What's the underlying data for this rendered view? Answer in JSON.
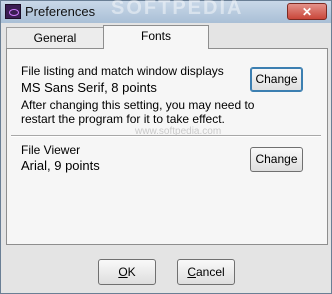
{
  "window": {
    "title": "Preferences",
    "close_glyph": "✕"
  },
  "tabs": [
    {
      "label": "General"
    },
    {
      "label": "Fonts"
    }
  ],
  "fonts": {
    "listing_label": "File listing and match window displays",
    "listing_value": "MS Sans Serif, 8 points",
    "note_line1": "After changing this setting, you may need to",
    "note_line2": "restart the program for it to take effect.",
    "change_label": "Change",
    "viewer_label": "File Viewer",
    "viewer_value": "Arial, 9 points"
  },
  "footer": {
    "ok_label": "OK",
    "ok_key": "O",
    "ok_rest": "K",
    "cancel_label": "Cancel",
    "cancel_key": "C",
    "cancel_rest": "ancel"
  },
  "watermark": {
    "main": "SOFTPEDIA",
    "url": "www.softpedia.com"
  }
}
